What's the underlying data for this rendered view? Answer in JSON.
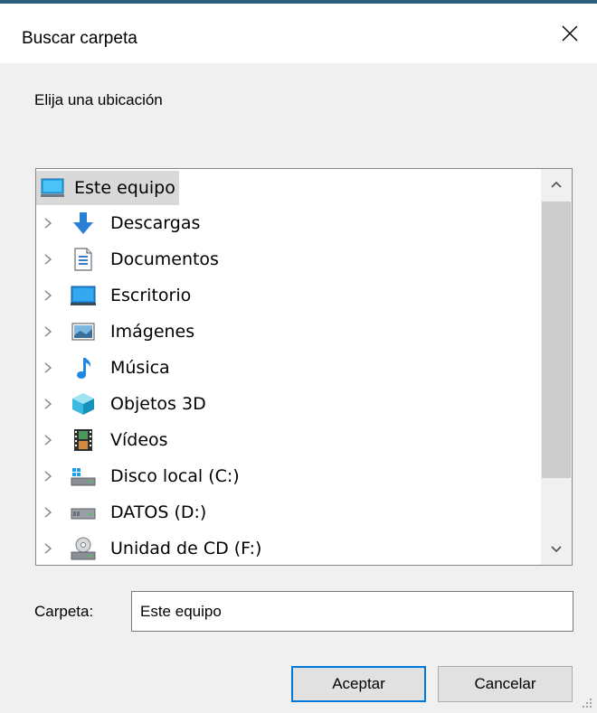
{
  "window": {
    "title": "Buscar carpeta",
    "close_glyph": "✕"
  },
  "prompt": "Elija una ubicación",
  "tree": {
    "root": {
      "label": "Este equipo",
      "icon": "computer-icon"
    },
    "items": [
      {
        "label": "Descargas",
        "icon": "download-arrow-icon"
      },
      {
        "label": "Documentos",
        "icon": "document-icon"
      },
      {
        "label": "Escritorio",
        "icon": "desktop-icon"
      },
      {
        "label": "Imágenes",
        "icon": "pictures-icon"
      },
      {
        "label": "Música",
        "icon": "music-note-icon"
      },
      {
        "label": "Objetos 3D",
        "icon": "cube-3d-icon"
      },
      {
        "label": "Vídeos",
        "icon": "film-icon"
      },
      {
        "label": "Disco local (C:)",
        "icon": "windows-drive-icon"
      },
      {
        "label": "DATOS (D:)",
        "icon": "drive-icon"
      },
      {
        "label": "Unidad de CD (F:)",
        "icon": "cd-drive-icon"
      }
    ],
    "expander_glyph": "›"
  },
  "folder": {
    "label": "Carpeta:",
    "value": "Este equipo"
  },
  "buttons": {
    "ok": "Aceptar",
    "cancel": "Cancelar"
  },
  "colors": {
    "accent": "#0078d7",
    "selection": "#d9d9d9",
    "title_border": "#2b5f7f"
  }
}
